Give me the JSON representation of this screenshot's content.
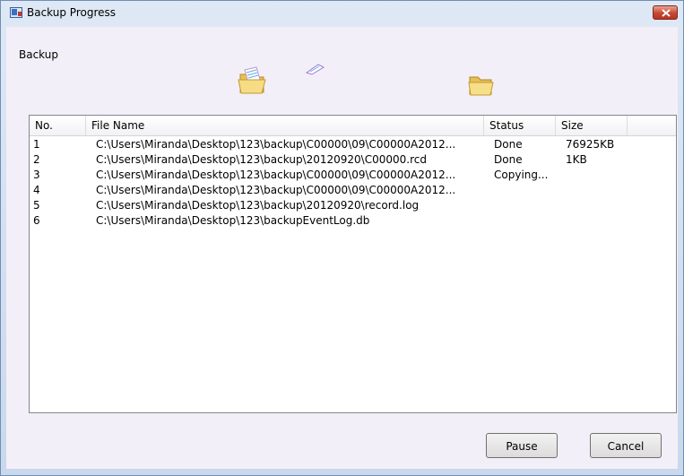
{
  "window": {
    "title": "Backup Progress"
  },
  "section_label": "Backup",
  "table": {
    "headers": {
      "no": "No.",
      "file_name": "File Name",
      "status": "Status",
      "size": "Size"
    },
    "rows": [
      {
        "no": "1",
        "file_name": "C:\\Users\\Miranda\\Desktop\\123\\backup\\C00000\\09\\C00000A2012...",
        "status": "Done",
        "size": "76925KB"
      },
      {
        "no": "2",
        "file_name": "C:\\Users\\Miranda\\Desktop\\123\\backup\\20120920\\C00000.rcd",
        "status": "Done",
        "size": "1KB"
      },
      {
        "no": "3",
        "file_name": "C:\\Users\\Miranda\\Desktop\\123\\backup\\C00000\\09\\C00000A2012...",
        "status": "Copying...",
        "size": ""
      },
      {
        "no": "4",
        "file_name": "C:\\Users\\Miranda\\Desktop\\123\\backup\\C00000\\09\\C00000A2012...",
        "status": "",
        "size": ""
      },
      {
        "no": "5",
        "file_name": "C:\\Users\\Miranda\\Desktop\\123\\backup\\20120920\\record.log",
        "status": "",
        "size": ""
      },
      {
        "no": "6",
        "file_name": "C:\\Users\\Miranda\\Desktop\\123\\backupEventLog.db",
        "status": "",
        "size": ""
      }
    ]
  },
  "buttons": {
    "pause": "Pause",
    "cancel": "Cancel"
  },
  "icons": {
    "app": "backup-app-icon",
    "close": "close-icon",
    "source_folder": "open-folder-icon",
    "flying_file": "flying-paper-icon",
    "destination_folder": "folder-icon"
  }
}
